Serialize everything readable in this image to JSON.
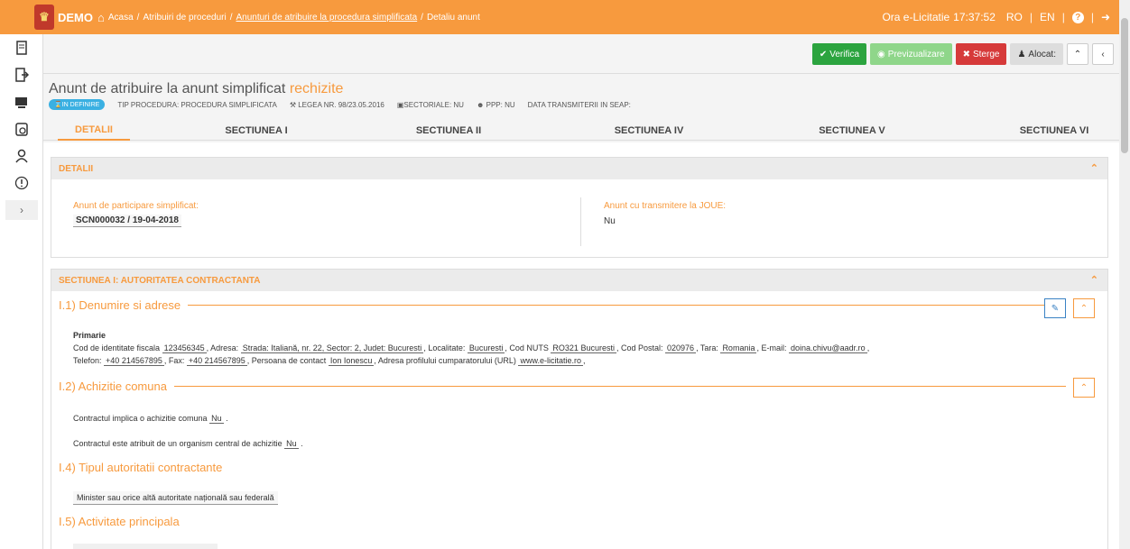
{
  "topbar": {
    "demo": "DEMO",
    "breadcrumb": [
      "Acasa",
      "/",
      "Atribuiri de proceduri",
      "/",
      "Anunturi de atribuire la procedura simplificata",
      "/",
      "Detaliu anunt"
    ],
    "clock_label": "Ora e-Licitatie",
    "clock_time": "17:37:52",
    "lang_ro": "RO",
    "lang_en": "EN",
    "sep": "|",
    "help": "?"
  },
  "toolbar": {
    "verifica": "Verifica",
    "previzualizare": "Previzualizare",
    "sterge": "Sterge",
    "alocat": "Alocat:"
  },
  "header": {
    "title_prefix": "Anunt de atribuire la anunt simplificat",
    "title_accent": "rechizite",
    "status": "IN DEFINIRE",
    "meta": [
      "TIP PROCEDURA: PROCEDURA SIMPLIFICATA",
      "LEGEA NR. 98/23.05.2016",
      "SECTORIALE: NU",
      "PPP: NU",
      "DATA TRANSMITERII IN SEAP:"
    ],
    "tabs": [
      "DETALII",
      "SECTIUNEA I",
      "SECTIUNEA II",
      "SECTIUNEA IV",
      "SECTIUNEA V",
      "SECTIUNEA VI"
    ]
  },
  "detalii": {
    "heading": "DETALII",
    "left_label": "Anunt de participare simplificat:",
    "left_value": "SCN000032 / 19-04-2018",
    "right_label": "Anunt cu transmitere la JOUE:",
    "right_value": "Nu"
  },
  "sectiunea1": {
    "heading": "SECTIUNEA I: AUTORITATEA CONTRACTANTA",
    "s11_title": "I.1) Denumire si adrese",
    "org": "Primarie",
    "fields": {
      "cif_label": "Cod de identitate fiscala",
      "cif": "123456345",
      "adresa_label": ", Adresa:",
      "adresa": "Strada: Italiană, nr. 22, Sector: 2, Judet: Bucuresti",
      "loc_label": ", Localitate:",
      "loc": "Bucuresti",
      "nuts_label": ", Cod NUTS",
      "nuts": "RO321 Bucuresti",
      "postal_label": ", Cod Postal:",
      "postal": "020976",
      "tara_label": ", Tara:",
      "tara": "Romania",
      "email_label": ", E-mail:",
      "email": "doina.chivu@aadr.ro",
      "end1": ",",
      "tel_label": "Telefon:",
      "tel": "+40 214567895",
      "fax_label": ", Fax:",
      "fax": "+40 214567895",
      "contact_label": ", Persoana de contact",
      "contact": "Ion Ionescu",
      "url_label": ", Adresa profilului cumparatorului (URL)",
      "url": "www.e-licitatie.ro",
      "end2": ","
    },
    "s12_title": "I.2) Achizitie comuna",
    "s12_q1": "Contractul implica o achizitie comuna",
    "s12_a1": "Nu",
    "s12_q2": "Contractul este atribuit de un organism central de achizitie",
    "s12_a2": "Nu",
    "dot": ".",
    "s14_title": "I.4) Tipul autoritatii contractante",
    "s14_value": "Minister sau orice altă autoritate națională sau federală",
    "s15_title": "I.5) Activitate principala"
  }
}
